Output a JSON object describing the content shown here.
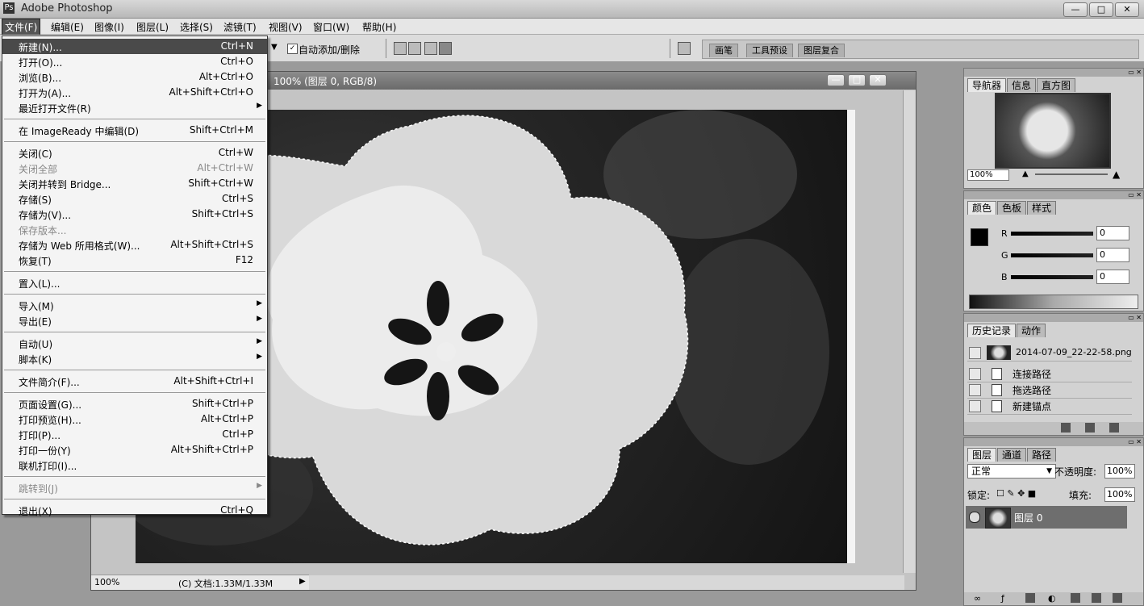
{
  "window": {
    "title": "Adobe Photoshop",
    "controls": [
      "—",
      "□",
      "✕"
    ]
  },
  "menubar": [
    "文件(F)",
    "编辑(E)",
    "图像(I)",
    "图层(L)",
    "选择(S)",
    "滤镜(T)",
    "视图(V)",
    "窗口(W)",
    "帮助(H)"
  ],
  "options": {
    "auto_add_delete": "自动添加/删除",
    "well_tabs": [
      "画笔",
      "工具预设",
      "图层复合"
    ]
  },
  "document": {
    "title": "100% (图层 0, RGB/8)",
    "status_zoom": "100%",
    "status_info": "(C) 文档:1.33M/1.33M"
  },
  "file_menu": {
    "items": [
      {
        "label": "新建(N)...",
        "shortcut": "Ctrl+N",
        "selected": true
      },
      {
        "label": "打开(O)...",
        "shortcut": "Ctrl+O"
      },
      {
        "label": "浏览(B)...",
        "shortcut": "Alt+Ctrl+O"
      },
      {
        "label": "打开为(A)...",
        "shortcut": "Alt+Shift+Ctrl+O"
      },
      {
        "label": "最近打开文件(R)",
        "shortcut": "",
        "submenu": true
      },
      {
        "label": "在 ImageReady 中编辑(D)",
        "shortcut": "Shift+Ctrl+M"
      },
      {
        "label": "关闭(C)",
        "shortcut": "Ctrl+W"
      },
      {
        "label": "关闭全部",
        "shortcut": "Alt+Ctrl+W",
        "disabled": true
      },
      {
        "label": "关闭并转到 Bridge...",
        "shortcut": "Shift+Ctrl+W"
      },
      {
        "label": "存储(S)",
        "shortcut": "Ctrl+S"
      },
      {
        "label": "存储为(V)...",
        "shortcut": "Shift+Ctrl+S"
      },
      {
        "label": "保存版本...",
        "shortcut": "",
        "disabled": true
      },
      {
        "label": "存储为 Web 所用格式(W)...",
        "shortcut": "Alt+Shift+Ctrl+S"
      },
      {
        "label": "恢复(T)",
        "shortcut": "F12"
      },
      {
        "label": "置入(L)...",
        "shortcut": ""
      },
      {
        "label": "导入(M)",
        "shortcut": "",
        "submenu": true
      },
      {
        "label": "导出(E)",
        "shortcut": "",
        "submenu": true
      },
      {
        "label": "自动(U)",
        "shortcut": "",
        "submenu": true
      },
      {
        "label": "脚本(K)",
        "shortcut": "",
        "submenu": true
      },
      {
        "label": "文件简介(F)...",
        "shortcut": "Alt+Shift+Ctrl+I"
      },
      {
        "label": "页面设置(G)...",
        "shortcut": "Shift+Ctrl+P"
      },
      {
        "label": "打印预览(H)...",
        "shortcut": "Alt+Ctrl+P"
      },
      {
        "label": "打印(P)...",
        "shortcut": "Ctrl+P"
      },
      {
        "label": "打印一份(Y)",
        "shortcut": "Alt+Shift+Ctrl+P"
      },
      {
        "label": "联机打印(I)...",
        "shortcut": ""
      },
      {
        "label": "跳转到(J)",
        "shortcut": "",
        "submenu": true,
        "disabled": true
      },
      {
        "label": "退出(X)",
        "shortcut": "Ctrl+Q"
      }
    ]
  },
  "navigator": {
    "tabs": [
      "导航器",
      "信息",
      "直方图"
    ],
    "zoom": "100%"
  },
  "color": {
    "tabs": [
      "颜色",
      "色板",
      "样式"
    ],
    "channels": [
      {
        "name": "R",
        "value": "0"
      },
      {
        "name": "G",
        "value": "0"
      },
      {
        "name": "B",
        "value": "0"
      }
    ]
  },
  "history": {
    "tabs": [
      "历史记录",
      "动作"
    ],
    "snapshot": "2014-07-09_22-22-58.png",
    "items": [
      "连接路径",
      "拖选路径",
      "新建锚点"
    ]
  },
  "layers": {
    "tabs": [
      "图层",
      "通道",
      "路径"
    ],
    "blend_mode": "正常",
    "opacity_label": "不透明度:",
    "opacity": "100%",
    "lock_label": "锁定:",
    "fill_label": "填充:",
    "fill": "100%",
    "layer_name": "图层 0"
  }
}
